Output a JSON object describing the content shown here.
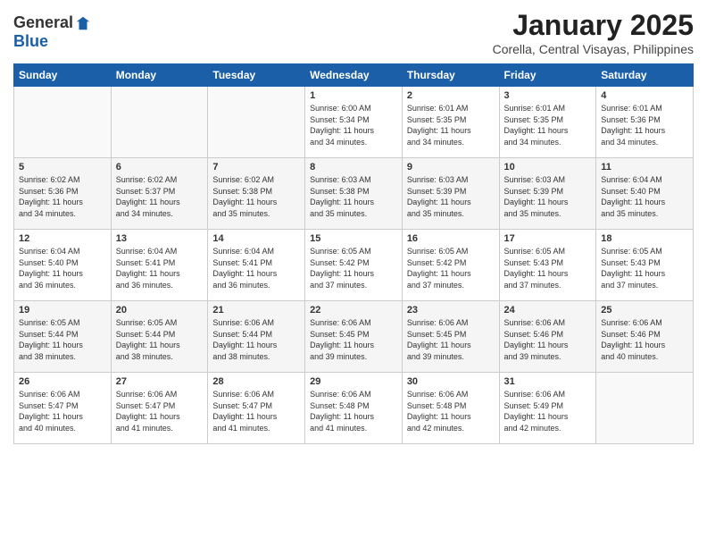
{
  "header": {
    "logo_line1": "General",
    "logo_line2": "Blue",
    "title": "January 2025",
    "subtitle": "Corella, Central Visayas, Philippines"
  },
  "days_of_week": [
    "Sunday",
    "Monday",
    "Tuesday",
    "Wednesday",
    "Thursday",
    "Friday",
    "Saturday"
  ],
  "weeks": [
    [
      {
        "day": "",
        "info": ""
      },
      {
        "day": "",
        "info": ""
      },
      {
        "day": "",
        "info": ""
      },
      {
        "day": "1",
        "info": "Sunrise: 6:00 AM\nSunset: 5:34 PM\nDaylight: 11 hours\nand 34 minutes."
      },
      {
        "day": "2",
        "info": "Sunrise: 6:01 AM\nSunset: 5:35 PM\nDaylight: 11 hours\nand 34 minutes."
      },
      {
        "day": "3",
        "info": "Sunrise: 6:01 AM\nSunset: 5:35 PM\nDaylight: 11 hours\nand 34 minutes."
      },
      {
        "day": "4",
        "info": "Sunrise: 6:01 AM\nSunset: 5:36 PM\nDaylight: 11 hours\nand 34 minutes."
      }
    ],
    [
      {
        "day": "5",
        "info": "Sunrise: 6:02 AM\nSunset: 5:36 PM\nDaylight: 11 hours\nand 34 minutes."
      },
      {
        "day": "6",
        "info": "Sunrise: 6:02 AM\nSunset: 5:37 PM\nDaylight: 11 hours\nand 34 minutes."
      },
      {
        "day": "7",
        "info": "Sunrise: 6:02 AM\nSunset: 5:38 PM\nDaylight: 11 hours\nand 35 minutes."
      },
      {
        "day": "8",
        "info": "Sunrise: 6:03 AM\nSunset: 5:38 PM\nDaylight: 11 hours\nand 35 minutes."
      },
      {
        "day": "9",
        "info": "Sunrise: 6:03 AM\nSunset: 5:39 PM\nDaylight: 11 hours\nand 35 minutes."
      },
      {
        "day": "10",
        "info": "Sunrise: 6:03 AM\nSunset: 5:39 PM\nDaylight: 11 hours\nand 35 minutes."
      },
      {
        "day": "11",
        "info": "Sunrise: 6:04 AM\nSunset: 5:40 PM\nDaylight: 11 hours\nand 35 minutes."
      }
    ],
    [
      {
        "day": "12",
        "info": "Sunrise: 6:04 AM\nSunset: 5:40 PM\nDaylight: 11 hours\nand 36 minutes."
      },
      {
        "day": "13",
        "info": "Sunrise: 6:04 AM\nSunset: 5:41 PM\nDaylight: 11 hours\nand 36 minutes."
      },
      {
        "day": "14",
        "info": "Sunrise: 6:04 AM\nSunset: 5:41 PM\nDaylight: 11 hours\nand 36 minutes."
      },
      {
        "day": "15",
        "info": "Sunrise: 6:05 AM\nSunset: 5:42 PM\nDaylight: 11 hours\nand 37 minutes."
      },
      {
        "day": "16",
        "info": "Sunrise: 6:05 AM\nSunset: 5:42 PM\nDaylight: 11 hours\nand 37 minutes."
      },
      {
        "day": "17",
        "info": "Sunrise: 6:05 AM\nSunset: 5:43 PM\nDaylight: 11 hours\nand 37 minutes."
      },
      {
        "day": "18",
        "info": "Sunrise: 6:05 AM\nSunset: 5:43 PM\nDaylight: 11 hours\nand 37 minutes."
      }
    ],
    [
      {
        "day": "19",
        "info": "Sunrise: 6:05 AM\nSunset: 5:44 PM\nDaylight: 11 hours\nand 38 minutes."
      },
      {
        "day": "20",
        "info": "Sunrise: 6:05 AM\nSunset: 5:44 PM\nDaylight: 11 hours\nand 38 minutes."
      },
      {
        "day": "21",
        "info": "Sunrise: 6:06 AM\nSunset: 5:44 PM\nDaylight: 11 hours\nand 38 minutes."
      },
      {
        "day": "22",
        "info": "Sunrise: 6:06 AM\nSunset: 5:45 PM\nDaylight: 11 hours\nand 39 minutes."
      },
      {
        "day": "23",
        "info": "Sunrise: 6:06 AM\nSunset: 5:45 PM\nDaylight: 11 hours\nand 39 minutes."
      },
      {
        "day": "24",
        "info": "Sunrise: 6:06 AM\nSunset: 5:46 PM\nDaylight: 11 hours\nand 39 minutes."
      },
      {
        "day": "25",
        "info": "Sunrise: 6:06 AM\nSunset: 5:46 PM\nDaylight: 11 hours\nand 40 minutes."
      }
    ],
    [
      {
        "day": "26",
        "info": "Sunrise: 6:06 AM\nSunset: 5:47 PM\nDaylight: 11 hours\nand 40 minutes."
      },
      {
        "day": "27",
        "info": "Sunrise: 6:06 AM\nSunset: 5:47 PM\nDaylight: 11 hours\nand 41 minutes."
      },
      {
        "day": "28",
        "info": "Sunrise: 6:06 AM\nSunset: 5:47 PM\nDaylight: 11 hours\nand 41 minutes."
      },
      {
        "day": "29",
        "info": "Sunrise: 6:06 AM\nSunset: 5:48 PM\nDaylight: 11 hours\nand 41 minutes."
      },
      {
        "day": "30",
        "info": "Sunrise: 6:06 AM\nSunset: 5:48 PM\nDaylight: 11 hours\nand 42 minutes."
      },
      {
        "day": "31",
        "info": "Sunrise: 6:06 AM\nSunset: 5:49 PM\nDaylight: 11 hours\nand 42 minutes."
      },
      {
        "day": "",
        "info": ""
      }
    ]
  ]
}
